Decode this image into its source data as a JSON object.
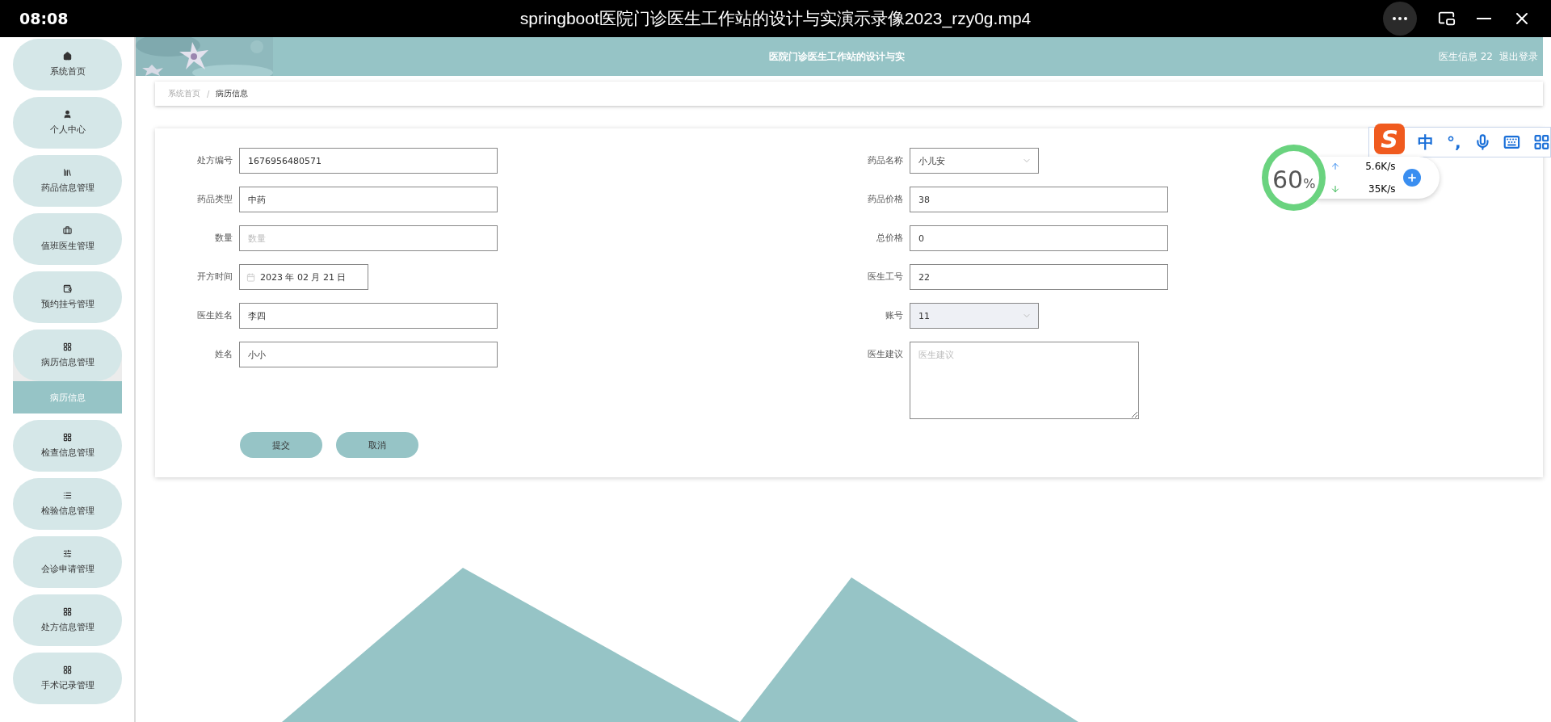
{
  "player_bar": {
    "time": "08:08",
    "title": "springboot医院门诊医生工作站的设计与实演示录像2023_rzy0g.mp4"
  },
  "sidebar": {
    "items": [
      {
        "label": "系统首页",
        "selected": false
      },
      {
        "label": "个人中心",
        "selected": false
      },
      {
        "label": "药品信息管理",
        "selected": false
      },
      {
        "label": "值班医生管理",
        "selected": false
      },
      {
        "label": "预约挂号管理",
        "selected": false
      },
      {
        "label": "病历信息管理",
        "selected": false,
        "expanded": true,
        "children": [
          {
            "label": "病历信息",
            "selected": true
          }
        ]
      },
      {
        "label": "检查信息管理",
        "selected": false
      },
      {
        "label": "检验信息管理",
        "selected": false
      },
      {
        "label": "会诊申请管理",
        "selected": false
      },
      {
        "label": "处方信息管理",
        "selected": false
      },
      {
        "label": "手术记录管理",
        "selected": false
      }
    ]
  },
  "header": {
    "title": "医院门诊医生工作站的设计与实",
    "user": "医生信息 22",
    "logout": "退出登录"
  },
  "breadcrumb": {
    "separator": "/",
    "items": [
      "系统首页",
      "病历信息"
    ]
  },
  "form": {
    "left": [
      {
        "kind": "text",
        "label": "处方编号",
        "value": "1676956480571",
        "disabled": false
      },
      {
        "kind": "text",
        "label": "药品类型",
        "value": "中药",
        "disabled": false
      },
      {
        "kind": "text",
        "label": "数量",
        "placeholder": "数量",
        "disabled": false
      },
      {
        "kind": "date",
        "label": "开方时间",
        "value": "2023 年 02 月 21 日",
        "disabled": false
      },
      {
        "kind": "text",
        "label": "医生姓名",
        "value": "李四",
        "disabled": false
      },
      {
        "kind": "text",
        "label": "姓名",
        "value": "小小",
        "disabled": false
      }
    ],
    "right": [
      {
        "kind": "select",
        "label": "药品名称",
        "value": "小儿安",
        "disabled": false
      },
      {
        "kind": "text",
        "label": "药品价格",
        "value": "38",
        "disabled": false
      },
      {
        "kind": "text",
        "label": "总价格",
        "value": "0",
        "disabled": false
      },
      {
        "kind": "text",
        "label": "医生工号",
        "value": "22",
        "disabled": false
      },
      {
        "kind": "select",
        "label": "账号",
        "value": "11",
        "disabled": true
      },
      {
        "kind": "textarea",
        "label": "医生建议",
        "placeholder": "医生建议",
        "disabled": false
      }
    ],
    "buttons": [
      "提交",
      "取消"
    ]
  },
  "ime_toolbar": {
    "logo": "S",
    "mode": "中",
    "punct": "°,"
  },
  "speed_widget": {
    "value": "60",
    "unit": "%",
    "upload": "5.6K/s",
    "download": "35K/s"
  }
}
